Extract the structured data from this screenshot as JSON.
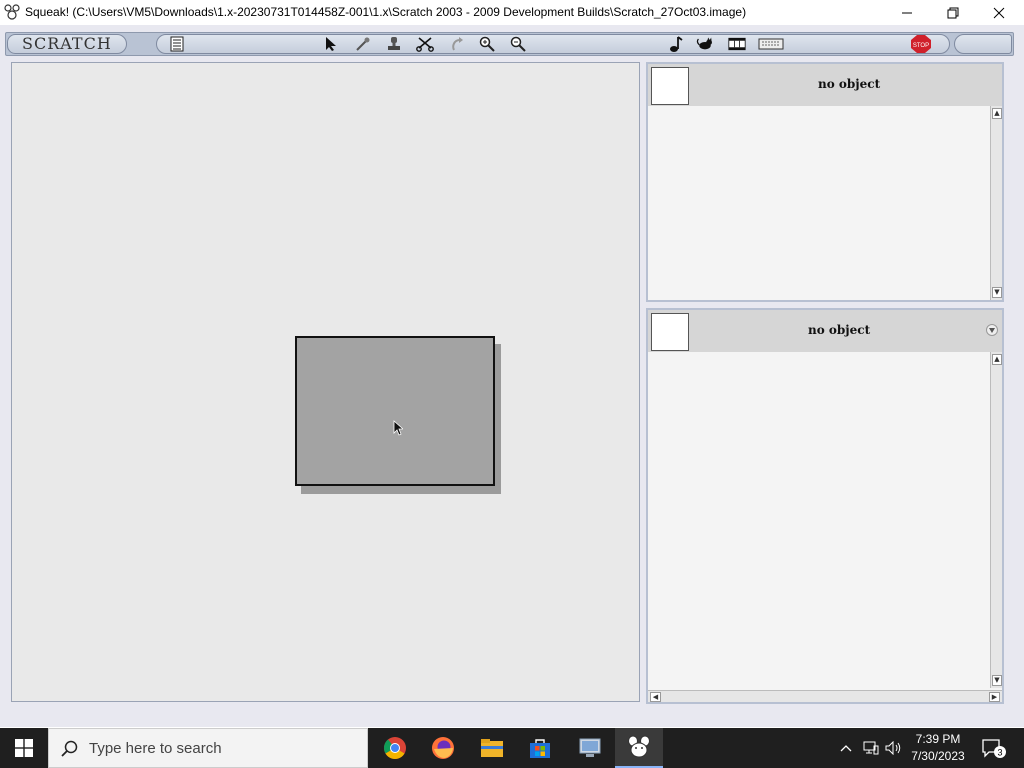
{
  "window": {
    "title": "Squeak! (C:\\Users\\VM5\\Downloads\\1.x-20230731T014458Z-001\\1.x\\Scratch 2003 - 2009 Development Builds\\Scratch_27Oct03.image)",
    "minimize_glyph": "—",
    "restore_glyph": "❐",
    "close_glyph": "✕"
  },
  "toolbar": {
    "scratch_label": "SCRATCH",
    "stop_label": "STOP",
    "tools": [
      "arrow-tool-icon",
      "eyedropper-tool-icon",
      "stamp-tool-icon",
      "scissors-tool-icon",
      "undo-tool-icon",
      "zoom-in-tool-icon",
      "zoom-out-tool-icon"
    ],
    "media_tools": [
      "music-note-icon",
      "cat-sprite-icon",
      "film-strip-icon",
      "keyboard-icon"
    ]
  },
  "panels": {
    "top": {
      "label": "no object"
    },
    "bottom": {
      "label": "no object"
    }
  },
  "taskbar": {
    "search_placeholder": "Type here to search",
    "time": "7:39 PM",
    "date": "7/30/2023",
    "notification_count": "3",
    "apps": [
      "chrome-icon",
      "firefox-icon",
      "file-explorer-icon",
      "store-icon",
      "control-panel-icon",
      "squeak-icon"
    ]
  },
  "colors": {
    "toolbar": "#b9c3d4",
    "stage": "#e9e9e9",
    "sprite": "#a3a3a3",
    "taskbar": "#1f1f1f",
    "stop": "#d0212b"
  }
}
